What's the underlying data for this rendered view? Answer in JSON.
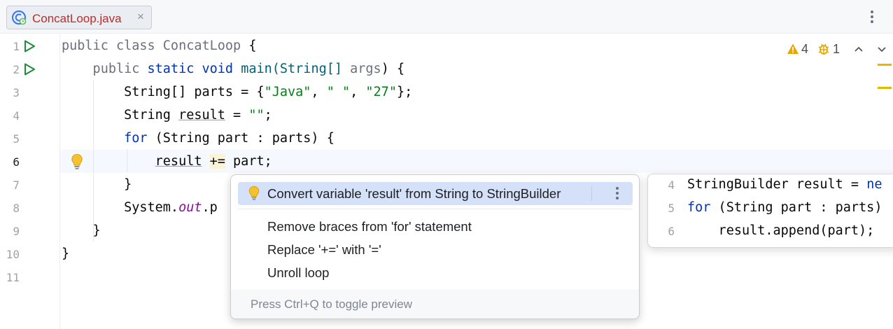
{
  "tab": {
    "filename": "ConcatLoop.java",
    "close_glyph": "×"
  },
  "line_numbers": [
    "1",
    "2",
    "3",
    "4",
    "5",
    "6",
    "7",
    "8",
    "9",
    "10",
    "11"
  ],
  "code": {
    "l1": {
      "a": "public class ",
      "b": "ConcatLoop",
      "c": " {"
    },
    "l2": {
      "a": "    public ",
      "kw1": "static",
      "sp1": " ",
      "kw2": "void",
      "b": " main(String[] ",
      "c": "args",
      "d": ") {"
    },
    "l3": {
      "a": "        String[] parts = {",
      "s1": "\"Java\"",
      "c1": ", ",
      "s2": "\" \"",
      "c2": ", ",
      "s3": "\"27\"",
      "d": "};"
    },
    "l4": {
      "a": "        String ",
      "u": "result",
      "b": " = ",
      "s": "\"\"",
      "c": ";"
    },
    "l5": {
      "a": "        ",
      "kw": "for",
      "b": " (String part : parts) {"
    },
    "l6": {
      "a": "            ",
      "u": "result",
      "sp": " ",
      "op": "+=",
      "b": " part;"
    },
    "l7": {
      "a": "        }"
    },
    "l8": {
      "a": "        System.",
      "f": "out",
      "b": ".p"
    },
    "l9": {
      "a": "    }"
    },
    "l10": {
      "a": "}"
    }
  },
  "inspections": {
    "warnings": "4",
    "weak_warnings": "1"
  },
  "popup": {
    "selected_item": "Convert variable 'result' from String to StringBuilder",
    "items": [
      "Remove braces from 'for' statement",
      "Replace '+=' with '='",
      "Unroll loop"
    ],
    "footer": "Press Ctrl+Q to toggle preview"
  },
  "preview": {
    "lines": [
      {
        "num": "4",
        "a": "StringBuilder result = ",
        "b": "ne"
      },
      {
        "num": "5",
        "kw": "for",
        "a": " (String part : parts)"
      },
      {
        "num": "6",
        "a": "    result.append(part);"
      }
    ]
  },
  "colors": {
    "accent": "#3574f0",
    "warning": "#e6a700",
    "string": "#067d17",
    "keyword": "#0033b3",
    "selection": "#d5e1f8"
  }
}
